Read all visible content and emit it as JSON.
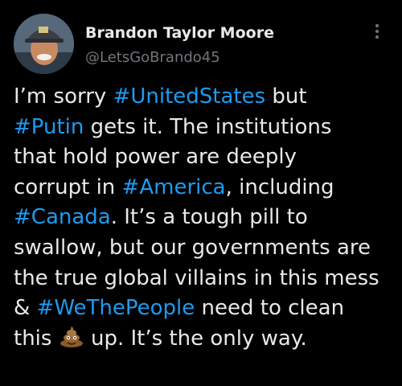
{
  "author": {
    "name": "Brandon Taylor Moore",
    "handle": "@LetsGoBrando45"
  },
  "icons": {
    "more": "more-vertical-icon",
    "emoji": "pile-of-poo-emoji"
  },
  "colors": {
    "background": "#000000",
    "text": "#e7e9ea",
    "muted": "#71767b",
    "hashtag": "#1d9bf0"
  },
  "tweet": {
    "lines": [
      [
        {
          "t": "I’m sorry ",
          "tag": false
        },
        {
          "t": "#UnitedStates",
          "tag": true
        },
        {
          "t": " but",
          "tag": false
        }
      ],
      [
        {
          "t": "#Putin",
          "tag": true
        },
        {
          "t": " gets it. The institutions",
          "tag": false
        }
      ],
      [
        {
          "t": "that hold power are deeply",
          "tag": false
        }
      ],
      [
        {
          "t": "corrupt in ",
          "tag": false
        },
        {
          "t": "#America",
          "tag": true
        },
        {
          "t": ", including",
          "tag": false
        }
      ],
      [
        {
          "t": "#Canada",
          "tag": true
        },
        {
          "t": ". It’s a tough pill to",
          "tag": false
        }
      ],
      [
        {
          "t": "swallow, but our governments are",
          "tag": false
        }
      ],
      [
        {
          "t": "the true global villains in this mess",
          "tag": false
        }
      ],
      [
        {
          "t": "& ",
          "tag": false
        },
        {
          "t": "#WeThePeople",
          "tag": true
        },
        {
          "t": " need to clean",
          "tag": false
        }
      ],
      [
        {
          "t": "this ",
          "tag": false
        },
        {
          "t": "",
          "emoji": true
        },
        {
          "t": " up. It’s the only way.",
          "tag": false
        }
      ]
    ]
  }
}
